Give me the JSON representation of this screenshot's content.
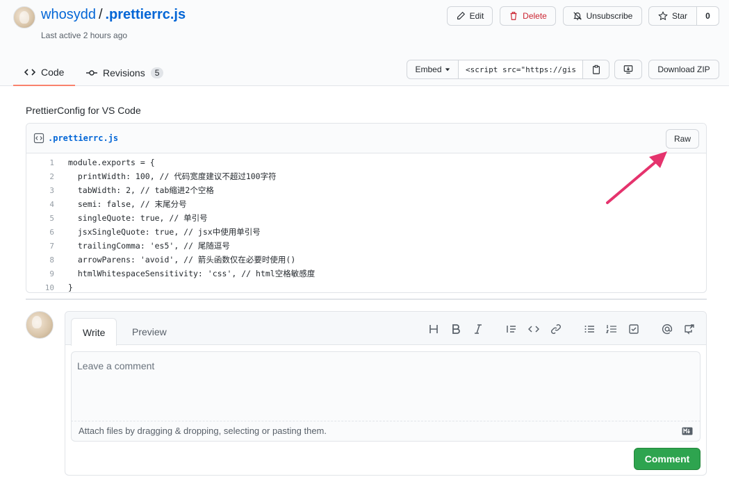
{
  "header": {
    "owner": "whosydd",
    "separator": "/",
    "gist_name": ".prettierrc.js",
    "last_active": "Last active 2 hours ago",
    "edit_label": "Edit",
    "delete_label": "Delete",
    "unsubscribe_label": "Unsubscribe",
    "star_label": "Star",
    "star_count": "0"
  },
  "tabs": {
    "code_label": "Code",
    "revisions_label": "Revisions",
    "revisions_count": "5"
  },
  "embed": {
    "embed_label": "Embed",
    "embed_value": "<script src=\"https://gist",
    "download_label": "Download ZIP"
  },
  "description": "PrettierConfig for VS Code",
  "file": {
    "name": ".prettierrc.js",
    "raw_label": "Raw",
    "lines": [
      {
        "n": "1",
        "text": "module.exports = {"
      },
      {
        "n": "2",
        "text": "  printWidth: 100, // 代码宽度建议不超过100字符"
      },
      {
        "n": "3",
        "text": "  tabWidth: 2, // tab缩进2个空格"
      },
      {
        "n": "4",
        "text": "  semi: false, // 末尾分号"
      },
      {
        "n": "5",
        "text": "  singleQuote: true, // 单引号"
      },
      {
        "n": "6",
        "text": "  jsxSingleQuote: true, // jsx中使用单引号"
      },
      {
        "n": "7",
        "text": "  trailingComma: 'es5', // 尾随逗号"
      },
      {
        "n": "8",
        "text": "  arrowParens: 'avoid', // 箭头函数仅在必要时使用()"
      },
      {
        "n": "9",
        "text": "  htmlWhitespaceSensitivity: 'css', // html空格敏感度"
      },
      {
        "n": "10",
        "text": "}"
      }
    ]
  },
  "comment": {
    "write_label": "Write",
    "preview_label": "Preview",
    "placeholder": "Leave a comment",
    "attach_text": "Attach files by dragging & dropping, selecting or pasting them.",
    "submit_label": "Comment"
  },
  "colors": {
    "accent": "#0366d6",
    "active_tab": "#f9826c",
    "danger": "#cb2431",
    "success": "#2ea44f",
    "annotation_arrow": "#e5336d"
  }
}
